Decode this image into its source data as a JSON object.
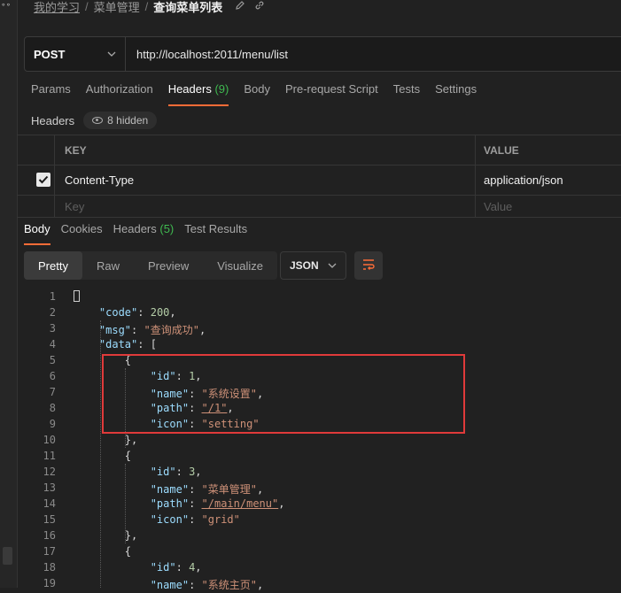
{
  "sidebar": {
    "dots": "∘∘"
  },
  "breadcrumb": {
    "items": [
      "我的学习",
      "菜单管理"
    ],
    "current": "查询菜单列表"
  },
  "request": {
    "method": "POST",
    "url": "http://localhost:2011/menu/list"
  },
  "req_tabs": {
    "params": "Params",
    "authorization": "Authorization",
    "headers": "Headers",
    "headers_count": "(9)",
    "body": "Body",
    "pre_request": "Pre-request Script",
    "tests": "Tests",
    "settings": "Settings"
  },
  "headers_section": {
    "label": "Headers",
    "hidden": "8 hidden"
  },
  "headers_table": {
    "col_key": "KEY",
    "col_value": "VALUE",
    "row": {
      "key": "Content-Type",
      "value": "application/json"
    },
    "placeholder_key": "Key",
    "placeholder_value": "Value"
  },
  "resp_tabs": {
    "body": "Body",
    "cookies": "Cookies",
    "headers": "Headers",
    "headers_count": "(5)",
    "test_results": "Test Results"
  },
  "view_modes": {
    "pretty": "Pretty",
    "raw": "Raw",
    "preview": "Preview",
    "visualize": "Visualize",
    "format": "JSON"
  },
  "code_lines": [
    {
      "num": "1",
      "text": "{"
    },
    {
      "num": "2",
      "text": "    \"code\": 200,"
    },
    {
      "num": "3",
      "text": "    \"msg\": \"查询成功\","
    },
    {
      "num": "4",
      "text": "    \"data\": ["
    },
    {
      "num": "5",
      "text": "        {"
    },
    {
      "num": "6",
      "text": "            \"id\": 1,"
    },
    {
      "num": "7",
      "text": "            \"name\": \"系统设置\","
    },
    {
      "num": "8",
      "text": "            \"path\": \"/1\","
    },
    {
      "num": "9",
      "text": "            \"icon\": \"setting\""
    },
    {
      "num": "10",
      "text": "        },"
    },
    {
      "num": "11",
      "text": "        {"
    },
    {
      "num": "12",
      "text": "            \"id\": 3,"
    },
    {
      "num": "13",
      "text": "            \"name\": \"菜单管理\","
    },
    {
      "num": "14",
      "text": "            \"path\": \"/main/menu\","
    },
    {
      "num": "15",
      "text": "            \"icon\": \"grid\""
    },
    {
      "num": "16",
      "text": "        },"
    },
    {
      "num": "17",
      "text": "        {"
    },
    {
      "num": "18",
      "text": "            \"id\": 4,"
    },
    {
      "num": "19",
      "text": "            \"name\": \"系统主页\","
    }
  ]
}
